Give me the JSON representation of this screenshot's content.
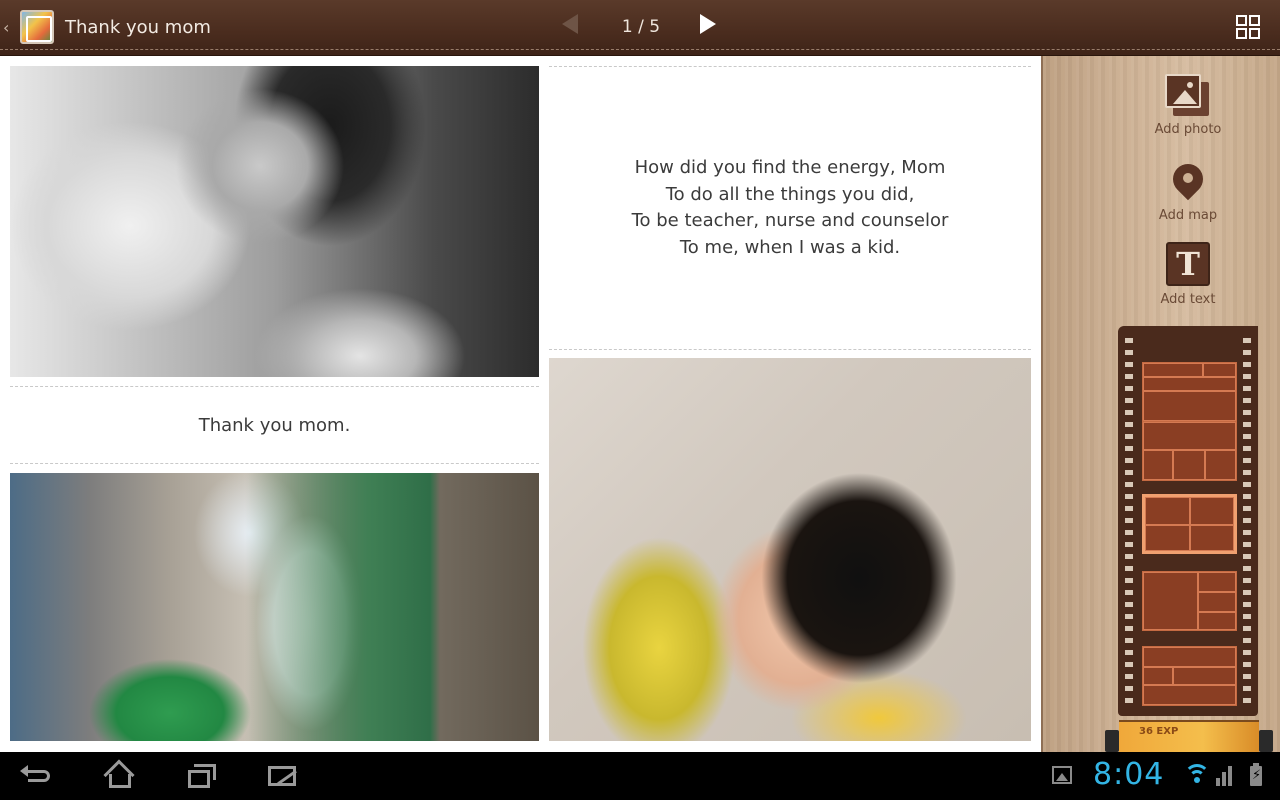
{
  "app": {
    "back_chevron": "‹",
    "title": "Thank you mom",
    "page_indicator": "1 / 5"
  },
  "icons": {
    "back": "chevron-left-icon",
    "album": "album-thumbnail-icon",
    "prev": "triangle-left-icon",
    "next": "triangle-right-icon",
    "layout": "grid-layout-icon"
  },
  "canvas": {
    "caption": "Thank you mom.",
    "poem": [
      "How did you find the energy, Mom",
      "To do all the things you did,",
      "To be teacher, nurse and counselor",
      "To me, when I was a kid."
    ]
  },
  "tools": {
    "add_photo": "Add photo",
    "add_map": "Add map",
    "add_text": "Add text",
    "text_icon_glyph": "T"
  },
  "film_strip": {
    "selected_frame": 3,
    "canister_label": "36 EXP"
  },
  "status_bar": {
    "time": "8:04",
    "battery_glyph": "⚡"
  },
  "colors": {
    "topbar": "#4a2c1e",
    "wood": "#cdb194",
    "clock": "#33b5e5"
  }
}
